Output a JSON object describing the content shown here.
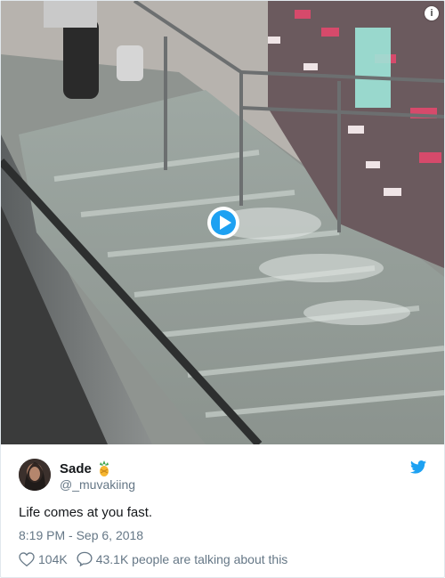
{
  "media": {
    "info_icon": "info-icon",
    "play_icon": "play-icon"
  },
  "tweet": {
    "display_name": "Sade",
    "name_emoji": "pineapple-icon",
    "handle": "@_muvakiing",
    "text": "Life comes at you fast.",
    "timestamp": "8:19 PM - Sep 6, 2018",
    "likes": "104K",
    "replies_label": "43.1K people are talking about this"
  },
  "colors": {
    "twitter_blue": "#1da1f2",
    "text_primary": "#14171a",
    "text_secondary": "#657786",
    "border": "#e1e8ed"
  }
}
